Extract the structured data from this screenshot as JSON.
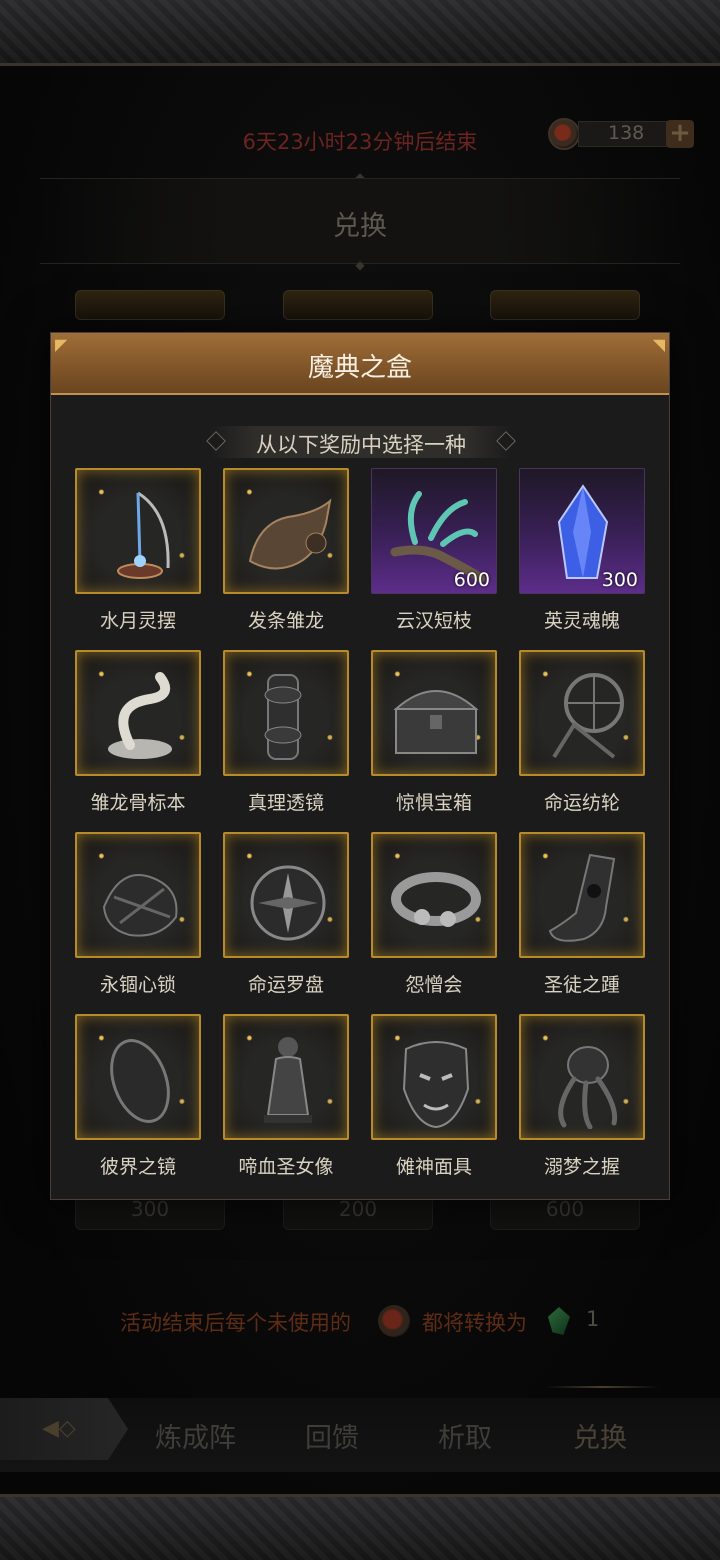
{
  "header": {
    "timer_text": "6天23小时23分钟后结束",
    "currency_count": "138",
    "plus_icon": "+",
    "exchange_title": "兑换"
  },
  "shop": {
    "prices": [
      "300",
      "200",
      "600"
    ]
  },
  "footer": {
    "note_before": "活动结束后每个未使用的",
    "note_after": "都将转换为",
    "gem_count": "1"
  },
  "nav": {
    "tabs": [
      "炼成阵",
      "回馈",
      "析取",
      "兑换"
    ],
    "active_tab": "兑换"
  },
  "modal": {
    "title": "魔典之盒",
    "subtitle": "从以下奖励中选择一种",
    "items": [
      {
        "name": "水月灵摆",
        "icon": "pendulum-icon",
        "rarity": "gold"
      },
      {
        "name": "发条雏龙",
        "icon": "dragon-icon",
        "rarity": "gold"
      },
      {
        "name": "云汉短枝",
        "icon": "branch-icon",
        "rarity": "purple",
        "qty": "600"
      },
      {
        "name": "英灵魂魄",
        "icon": "crystal-icon",
        "rarity": "purple",
        "qty": "300"
      },
      {
        "name": "雏龙骨标本",
        "icon": "bone-specimen-icon",
        "rarity": "gold"
      },
      {
        "name": "真理透镜",
        "icon": "lens-icon",
        "rarity": "gold"
      },
      {
        "name": "惊惧宝箱",
        "icon": "chest-icon",
        "rarity": "gold"
      },
      {
        "name": "命运纺轮",
        "icon": "spinning-wheel-icon",
        "rarity": "gold"
      },
      {
        "name": "永锢心锁",
        "icon": "heart-lock-icon",
        "rarity": "gold"
      },
      {
        "name": "命运罗盘",
        "icon": "compass-icon",
        "rarity": "gold"
      },
      {
        "name": "怨憎会",
        "icon": "bracelet-icon",
        "rarity": "gold"
      },
      {
        "name": "圣徒之踵",
        "icon": "foot-icon",
        "rarity": "gold"
      },
      {
        "name": "彼界之镜",
        "icon": "mirror-icon",
        "rarity": "gold"
      },
      {
        "name": "啼血圣女像",
        "icon": "statue-icon",
        "rarity": "gold"
      },
      {
        "name": "傩神面具",
        "icon": "mask-icon",
        "rarity": "gold"
      },
      {
        "name": "溺梦之握",
        "icon": "claw-icon",
        "rarity": "gold"
      }
    ]
  }
}
